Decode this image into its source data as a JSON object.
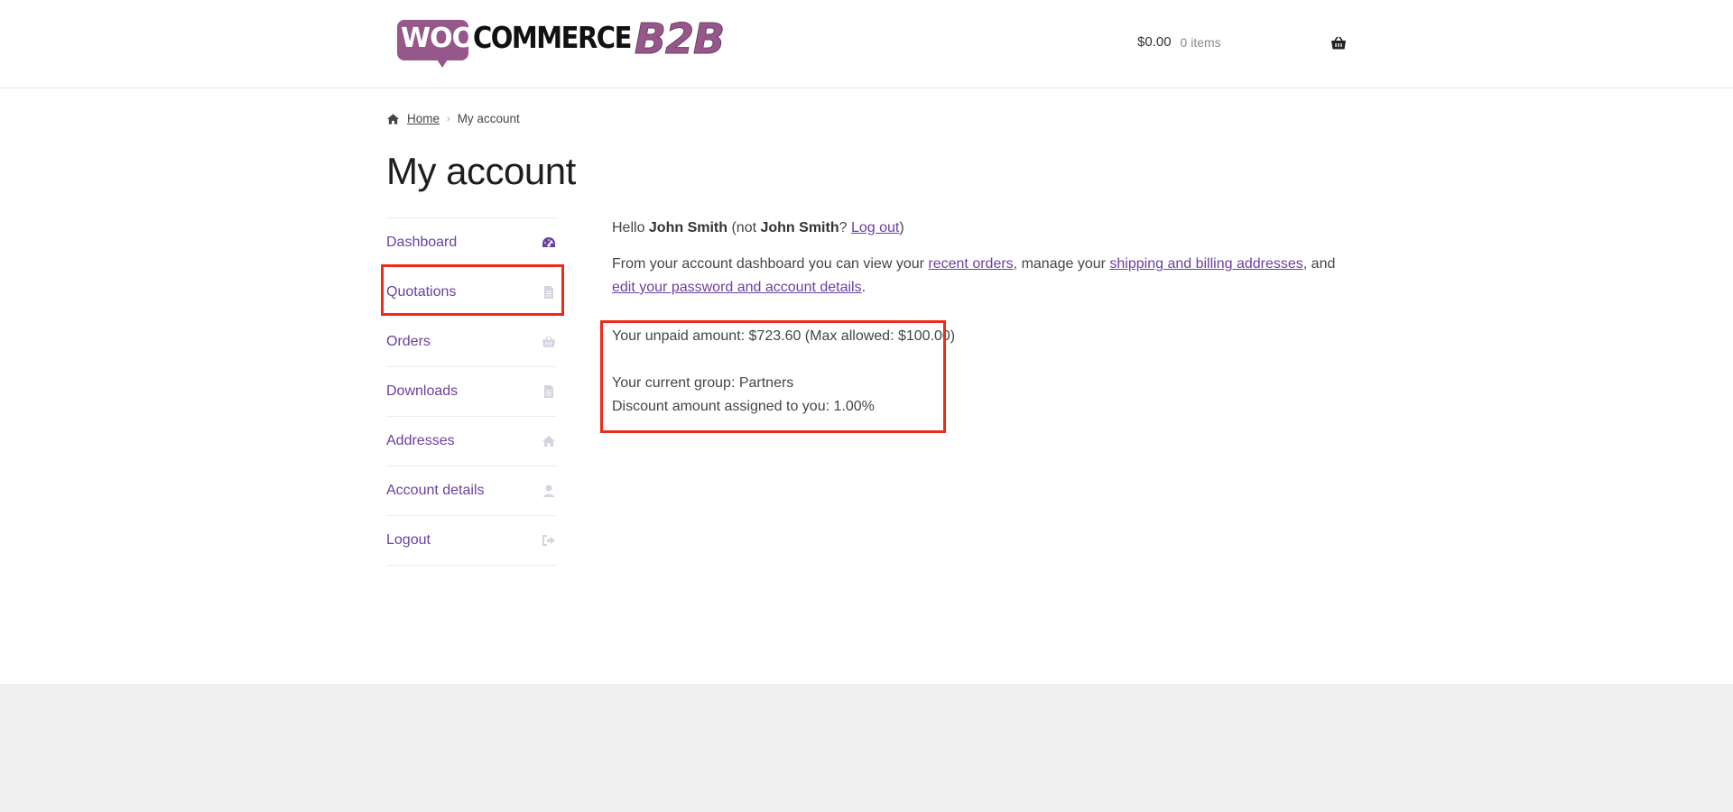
{
  "header": {
    "logo": {
      "woo": "WOO",
      "commerce": "COMMERCE",
      "b2b": "B2B"
    },
    "cart": {
      "amount": "$0.00",
      "count": "0 items",
      "icon": "basket-icon"
    }
  },
  "breadcrumb": {
    "home": "Home",
    "current": "My account"
  },
  "page": {
    "title": "My account"
  },
  "sidebar": {
    "items": [
      {
        "label": "Dashboard",
        "icon": "dashboard-icon"
      },
      {
        "label": "Quotations",
        "icon": "document-icon"
      },
      {
        "label": "Orders",
        "icon": "basket-icon"
      },
      {
        "label": "Downloads",
        "icon": "file-icon"
      },
      {
        "label": "Addresses",
        "icon": "home-icon"
      },
      {
        "label": "Account details",
        "icon": "user-icon"
      },
      {
        "label": "Logout",
        "icon": "sign-out-icon"
      }
    ]
  },
  "content": {
    "greeting_prefix": "Hello ",
    "user_name": "John Smith",
    "greeting_mid": " (not ",
    "user_name_2": "John Smith",
    "greeting_q": "? ",
    "logout_link": "Log out",
    "greeting_end": ")",
    "dashboard_intro": "From your account dashboard you can view your ",
    "recent_orders_link": "recent orders",
    "manage_text": ", manage your ",
    "addresses_link": "shipping and billing addresses",
    "and_text": ", and ",
    "edit_link": "edit your password and account details",
    "period": "."
  },
  "b2b": {
    "unpaid": "Your unpaid amount: $723.60 (Max allowed: $100.00)",
    "group": "Your current group: Partners",
    "discount": "Discount amount assigned to you: 1.00%"
  },
  "colors": {
    "accent": "#6d3fa0",
    "brand": "#96588a",
    "highlight": "#ee2a1b",
    "footer": "#f0f0f0"
  }
}
